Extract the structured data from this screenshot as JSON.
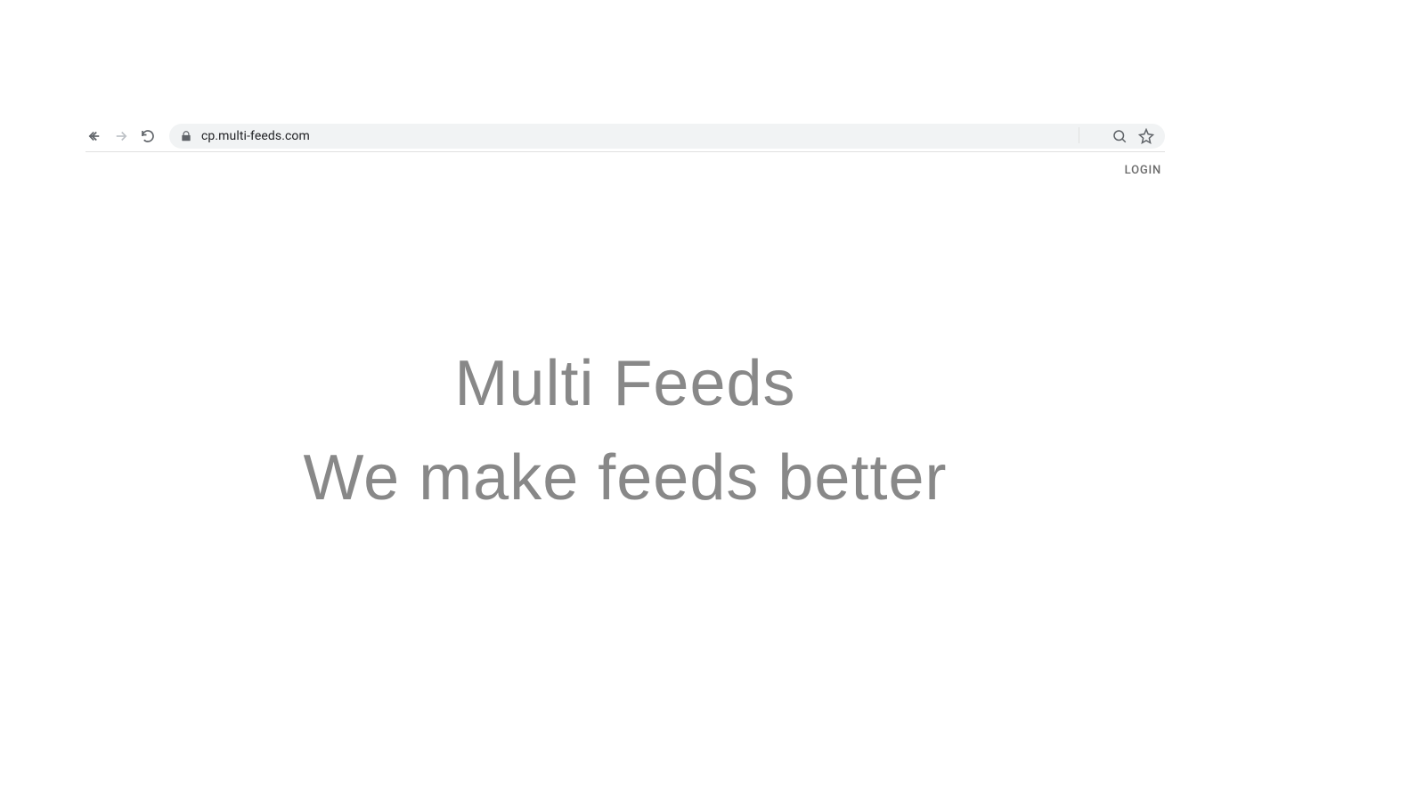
{
  "browser": {
    "url": "cp.multi-feeds.com"
  },
  "header": {
    "login_label": "LOGIN"
  },
  "hero": {
    "title": "Multi Feeds",
    "subtitle": "We make feeds better"
  }
}
